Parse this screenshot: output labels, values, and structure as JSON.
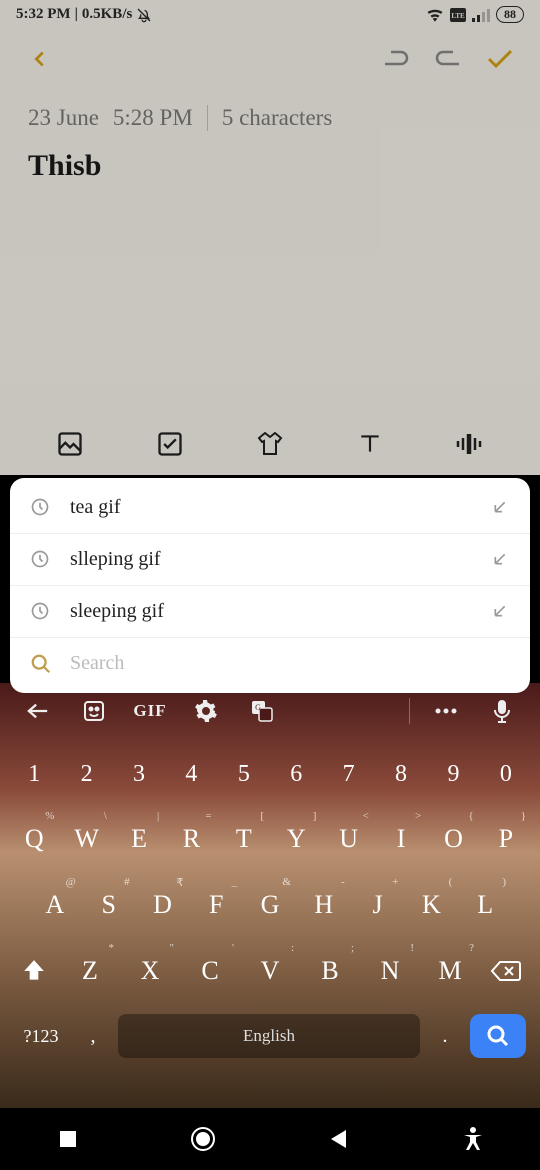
{
  "status": {
    "time": "5:32 PM",
    "speed": "0.5KB/s",
    "battery": "88"
  },
  "note": {
    "date": "23 June",
    "time": "5:28 PM",
    "char_count": "5 characters",
    "content": "Thisb"
  },
  "search": {
    "items": [
      {
        "text": "tea gif"
      },
      {
        "text": "slleping gif"
      },
      {
        "text": "sleeping gif"
      }
    ],
    "placeholder": "Search"
  },
  "keyboard": {
    "gif_label": "GIF",
    "numbers": [
      "1",
      "2",
      "3",
      "4",
      "5",
      "6",
      "7",
      "8",
      "9",
      "0"
    ],
    "row1": [
      {
        "k": "Q",
        "h": "%"
      },
      {
        "k": "W",
        "h": "\\"
      },
      {
        "k": "E",
        "h": "|"
      },
      {
        "k": "R",
        "h": "="
      },
      {
        "k": "T",
        "h": "["
      },
      {
        "k": "Y",
        "h": "]"
      },
      {
        "k": "U",
        "h": "<"
      },
      {
        "k": "I",
        "h": ">"
      },
      {
        "k": "O",
        "h": "{"
      },
      {
        "k": "P",
        "h": "}"
      }
    ],
    "row2": [
      {
        "k": "A",
        "h": "@"
      },
      {
        "k": "S",
        "h": "#"
      },
      {
        "k": "D",
        "h": "₹"
      },
      {
        "k": "F",
        "h": "_"
      },
      {
        "k": "G",
        "h": "&"
      },
      {
        "k": "H",
        "h": "-"
      },
      {
        "k": "J",
        "h": "+"
      },
      {
        "k": "K",
        "h": "("
      },
      {
        "k": "L",
        "h": ")"
      }
    ],
    "row3": [
      {
        "k": "Z",
        "h": "*"
      },
      {
        "k": "X",
        "h": "\""
      },
      {
        "k": "C",
        "h": "'"
      },
      {
        "k": "V",
        "h": ":"
      },
      {
        "k": "B",
        "h": ";"
      },
      {
        "k": "N",
        "h": "!"
      },
      {
        "k": "M",
        "h": "?"
      }
    ],
    "sym": "?123",
    "space": "English"
  }
}
